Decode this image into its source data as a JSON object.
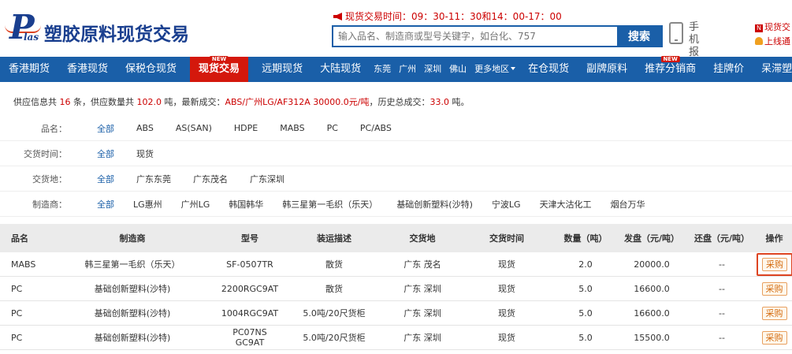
{
  "header": {
    "brand": "塑胶原料现货交易",
    "logo_letter": "P",
    "logo_sub": "las",
    "trade_time": "现货交易时间：09：30-11：30和14：00-17：00",
    "search": {
      "placeholder": "输入品名、制造商或型号关键字，如台化、757",
      "button": "搜索"
    },
    "mobile": "手机报价",
    "right_top": "现货交",
    "right_bottom": "上线通"
  },
  "nav": {
    "items": [
      "香港期货",
      "香港现货",
      "保税仓现货",
      "现货交易",
      "远期现货",
      "大陆现货",
      "东莞",
      "广州",
      "深圳",
      "佛山",
      "更多地区",
      "在仓现货",
      "副牌原料",
      "推荐分销商",
      "挂牌价",
      "呆滞塑料"
    ],
    "new_tag": "NEW"
  },
  "info": {
    "prefix": "供应信息共 ",
    "count": "16",
    "count_unit": " 条，供应数量共 ",
    "qty": "102.0",
    "qty_unit": " 吨，最新成交：",
    "latest": "ABS/广州LG/AF312A 30000.0元/吨",
    "mid": "，历史总成交：",
    "total": "33.0",
    "suffix": " 吨。"
  },
  "filters": [
    {
      "label": "品名：",
      "options": [
        "全部",
        "ABS",
        "AS(SAN)",
        "HDPE",
        "MABS",
        "PC",
        "PC/ABS"
      ]
    },
    {
      "label": "交货时间：",
      "options": [
        "全部",
        "现货"
      ]
    },
    {
      "label": "交货地：",
      "options": [
        "全部",
        "广东东莞",
        "广东茂名",
        "广东深圳"
      ]
    },
    {
      "label": "制造商：",
      "options": [
        "全部",
        "LG惠州",
        "广州LG",
        "韩国韩华",
        "韩三星第一毛织（乐天）",
        "基础创新塑料(沙特)",
        "宁波LG",
        "天津大沽化工",
        "烟台万华"
      ]
    }
  ],
  "table": {
    "headers": [
      "品名",
      "制造商",
      "型号",
      "装运描述",
      "交货地",
      "交货时间",
      "数量（吨）",
      "发盘（元/吨）",
      "还盘（元/吨）",
      "操作"
    ],
    "rows": [
      [
        "MABS",
        "韩三星第一毛织（乐天）",
        "SF-0507TR",
        "散货",
        "广东 茂名",
        "现货",
        "2.0",
        "20000.0",
        "--",
        "采购"
      ],
      [
        "PC",
        "基础创新塑料(沙特)",
        "2200RGC9AT",
        "散货",
        "广东 深圳",
        "现货",
        "5.0",
        "16600.0",
        "--",
        "采购"
      ],
      [
        "PC",
        "基础创新塑料(沙特)",
        "1004RGC9AT",
        "5.0吨/20尺货柜",
        "广东 深圳",
        "现货",
        "5.0",
        "16600.0",
        "--",
        "采购"
      ],
      [
        "PC",
        "基础创新塑料(沙特)",
        "PC07NS GC9AT",
        "5.0吨/20尺货柜",
        "广东 深圳",
        "现货",
        "5.0",
        "15500.0",
        "--",
        "采购"
      ]
    ]
  }
}
